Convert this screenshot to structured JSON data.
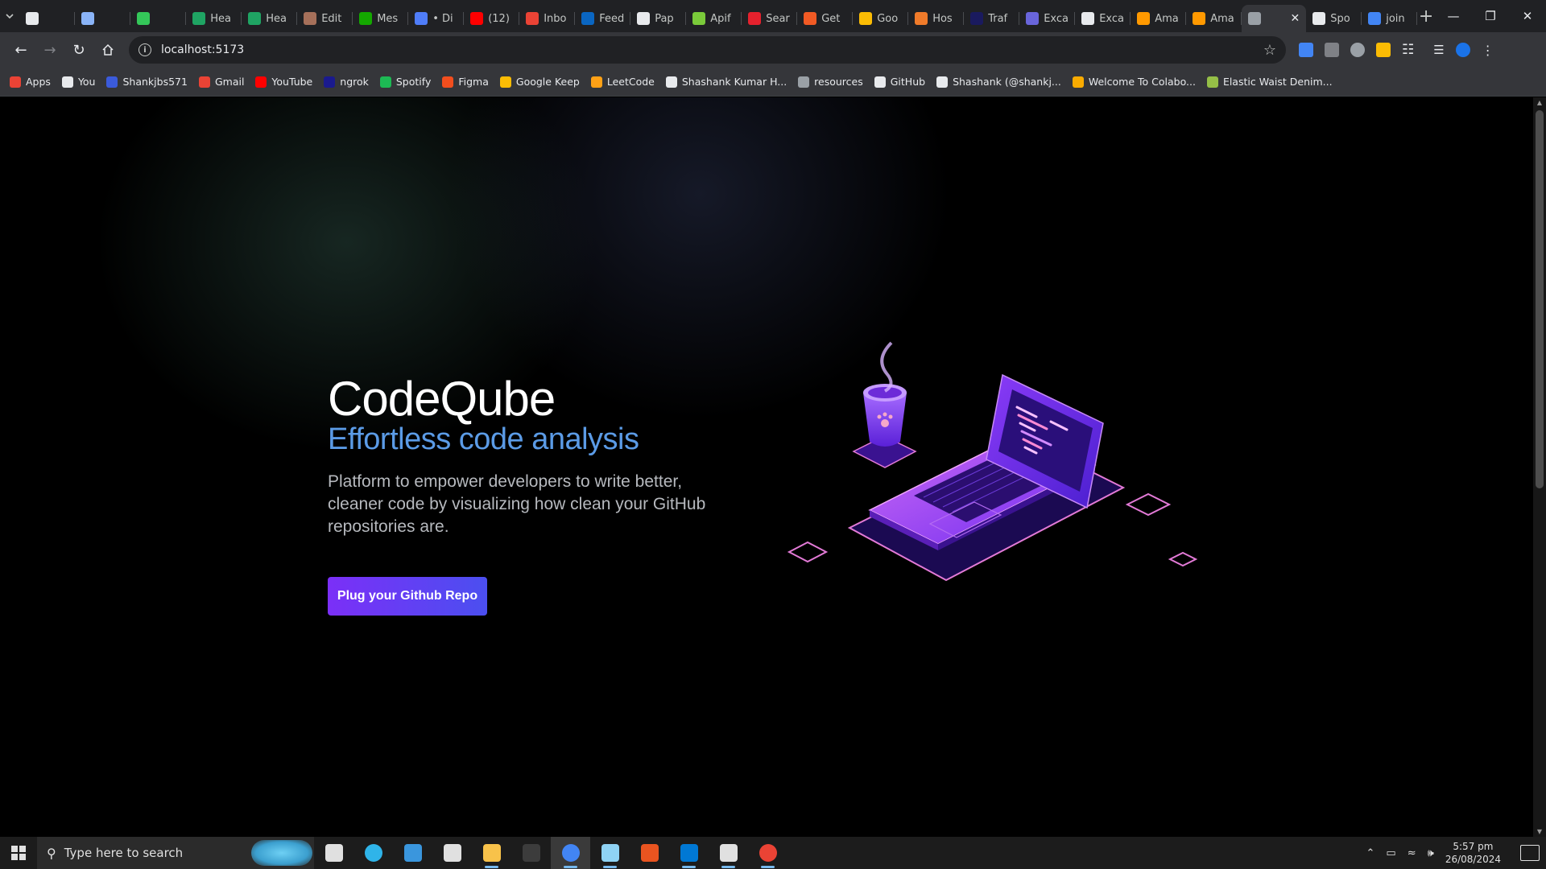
{
  "browser": {
    "tabs": [
      {
        "label": "",
        "color": "#e8eaed"
      },
      {
        "label": "",
        "color": "#8ab4f8"
      },
      {
        "label": "",
        "color": "#34c759"
      },
      {
        "label": "Hea",
        "color": "#1fa463"
      },
      {
        "label": "Hea",
        "color": "#1fa463"
      },
      {
        "label": "Edit",
        "color": "#a6705a"
      },
      {
        "label": "Mes",
        "color": "#14a800"
      },
      {
        "label": "• Di",
        "color": "#4f7df9"
      },
      {
        "label": "(12)",
        "color": "#ff0000"
      },
      {
        "label": "Inbo",
        "color": "#ea4335"
      },
      {
        "label": "Feed",
        "color": "#0a66c2"
      },
      {
        "label": "Pap",
        "color": "#e8eaed"
      },
      {
        "label": "Apif",
        "color": "#7aca3a"
      },
      {
        "label": "Sear",
        "color": "#e5212d"
      },
      {
        "label": "Get",
        "color": "#f15a24"
      },
      {
        "label": "Goo",
        "color": "#fbbc04"
      },
      {
        "label": "Hos",
        "color": "#f07b2a"
      },
      {
        "label": "Traf",
        "color": "#1a1a5e"
      },
      {
        "label": "Exca",
        "color": "#6965db"
      },
      {
        "label": "Exca",
        "color": "#e8eaed"
      },
      {
        "label": "Ama",
        "color": "#ff9900"
      },
      {
        "label": "Ama",
        "color": "#ff9900"
      },
      {
        "label": "",
        "color": "#9aa0a6",
        "active": true
      },
      {
        "label": "Spo",
        "color": "#e8eaed"
      },
      {
        "label": "join",
        "color": "#4285f4"
      }
    ],
    "url": "localhost:5173",
    "bookmarks": [
      {
        "label": "Apps",
        "color": "#ea4335"
      },
      {
        "label": "You",
        "color": "#e8eaed"
      },
      {
        "label": "Shankjbs571",
        "color": "#3b5bdb"
      },
      {
        "label": "Gmail",
        "color": "#ea4335"
      },
      {
        "label": "YouTube",
        "color": "#ff0000"
      },
      {
        "label": "ngrok",
        "color": "#1a1a8e"
      },
      {
        "label": "Spotify",
        "color": "#1db954"
      },
      {
        "label": "Figma",
        "color": "#f24e1e"
      },
      {
        "label": "Google Keep",
        "color": "#fbbc04"
      },
      {
        "label": "LeetCode",
        "color": "#ffa116"
      },
      {
        "label": "Shashank Kumar H...",
        "color": "#e8eaed"
      },
      {
        "label": "resources",
        "color": "#9aa0a6"
      },
      {
        "label": "GitHub",
        "color": "#e8eaed"
      },
      {
        "label": "Shashank (@shankj...",
        "color": "#e8eaed"
      },
      {
        "label": "Welcome To Colabo...",
        "color": "#f9ab00"
      },
      {
        "label": "Elastic Waist Denim...",
        "color": "#95bf47"
      }
    ]
  },
  "hero": {
    "title": "CodeQube",
    "subtitle": "Effortless code analysis",
    "description": "Platform to empower developers to write better, cleaner code by visualizing how clean your GitHub repositories are.",
    "cta_label": "Plug your Github Repo"
  },
  "taskbar": {
    "search_placeholder": "Type here to search",
    "time": "5:57 pm",
    "date": "26/08/2024",
    "apps": [
      {
        "name": "task-view",
        "color": "#e0e0e0"
      },
      {
        "name": "edge",
        "color": "#2fb4e9"
      },
      {
        "name": "store",
        "color": "#3a96dd"
      },
      {
        "name": "mail",
        "color": "#e0e0e0"
      },
      {
        "name": "file-explorer",
        "color": "#f8c24a"
      },
      {
        "name": "terminal",
        "color": "#3c3c3c"
      },
      {
        "name": "chrome",
        "color": "#4285f4",
        "active": true
      },
      {
        "name": "notepad",
        "color": "#8fd3f4"
      },
      {
        "name": "ubuntu",
        "color": "#e95420"
      },
      {
        "name": "vscode",
        "color": "#0078d4"
      },
      {
        "name": "inkscape",
        "color": "#e0e0e0"
      },
      {
        "name": "chrome-canary",
        "color": "#ea4335"
      }
    ]
  }
}
